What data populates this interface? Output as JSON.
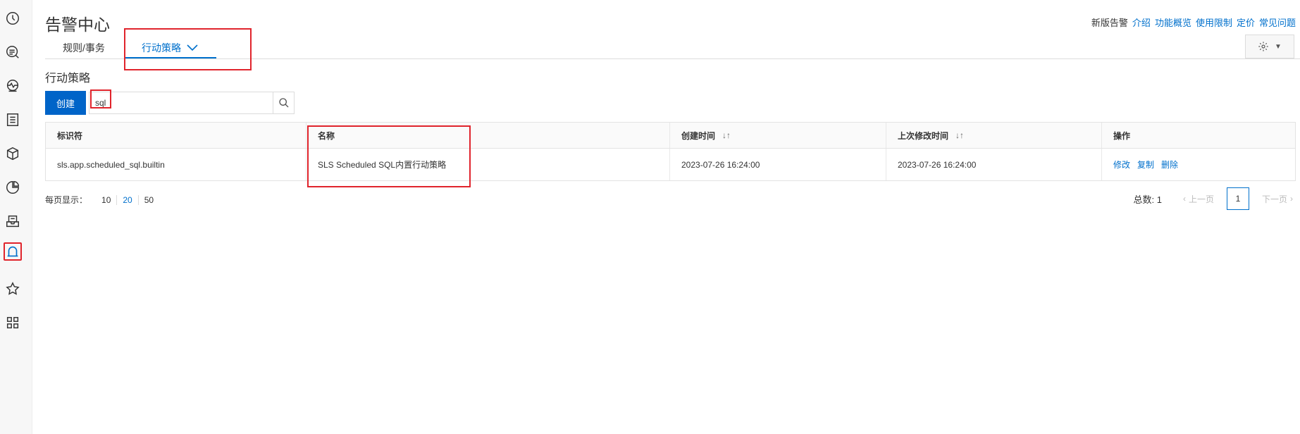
{
  "header": {
    "title": "告警中心",
    "links": [
      {
        "label": "新版告警",
        "is_link": false
      },
      {
        "label": "介绍",
        "is_link": true
      },
      {
        "label": "功能概览",
        "is_link": true
      },
      {
        "label": "使用限制",
        "is_link": true
      },
      {
        "label": "定价",
        "is_link": true
      },
      {
        "label": "常见问题",
        "is_link": true
      }
    ]
  },
  "tabs": [
    {
      "label": "规则/事务",
      "active": false
    },
    {
      "label": "行动策略",
      "active": true
    }
  ],
  "section": {
    "title": "行动策略",
    "create_label": "创建",
    "search_value": "sql",
    "search_placeholder": ""
  },
  "table": {
    "columns": [
      "标识符",
      "名称",
      "创建时间",
      "上次修改时间",
      "操作"
    ],
    "rows": [
      {
        "id": "sls.app.scheduled_sql.builtin",
        "name": "SLS Scheduled SQL内置行动策略",
        "created": "2023-07-26 16:24:00",
        "modified": "2023-07-26 16:24:00",
        "actions": [
          "修改",
          "复制",
          "删除"
        ]
      }
    ]
  },
  "pagination": {
    "page_size_label": "每页显示：",
    "page_sizes": [
      "10",
      "20",
      "50"
    ],
    "selected_page_size": "20",
    "total_label": "总数: 1",
    "prev_label": "上一页",
    "next_label": "下一页",
    "current_page": "1"
  },
  "sidebar": {
    "icons": [
      "clock-icon",
      "search-list-icon",
      "monitor-pulse-icon",
      "list-panel-icon",
      "box-icon",
      "pie-chart-icon",
      "inbox-icon",
      "bell-icon",
      "star-icon",
      "grid-icon"
    ],
    "active": "bell-icon"
  },
  "colors": {
    "accent": "#0070cc",
    "primary_button": "#0064c8",
    "highlight_box": "#e0242c"
  }
}
